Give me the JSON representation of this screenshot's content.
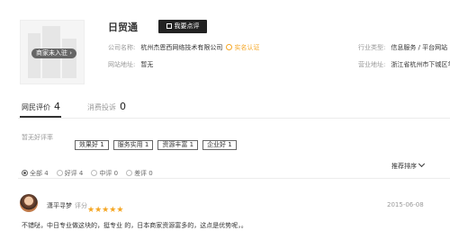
{
  "company": {
    "name": "日贸通",
    "logo_badge": "商家未入驻",
    "review_button": "我要点评",
    "company_name_label": "公司名称:",
    "company_name": "杭州杰恩西网络技术有限公司",
    "cert_label": "实名认证",
    "website_label": "网站地址:",
    "website": "暂无",
    "industry_label": "行业类型:",
    "industry": "信息服务 / 平台网站",
    "address_label": "营业地址:",
    "address": "浙江省杭州市下城区华"
  },
  "tabs": [
    {
      "label": "网民评价",
      "count": "4"
    },
    {
      "label": "消费投诉",
      "count": "0"
    }
  ],
  "tags": {
    "empty_label": "暂无好评率",
    "items": [
      "效果好 1",
      "服务实用 1",
      "资源丰富 1",
      "企业好 1"
    ]
  },
  "filters": {
    "options": [
      {
        "label": "全部 4",
        "selected": true
      },
      {
        "label": "好评 4",
        "selected": false
      },
      {
        "label": "中评 0",
        "selected": false
      },
      {
        "label": "差评 0",
        "selected": false
      }
    ],
    "sort_label": "推荐排序"
  },
  "review": {
    "user": "潇平寻梦",
    "rating_label": "评分",
    "rating": 5,
    "date": "2015-06-08",
    "content": "不错哒，中日专业做这块的，挺专业 的，日本商家资源富多的，这点是优势呢，。"
  },
  "colors": {
    "accent": "#f5a623",
    "button_bg": "#222222"
  }
}
